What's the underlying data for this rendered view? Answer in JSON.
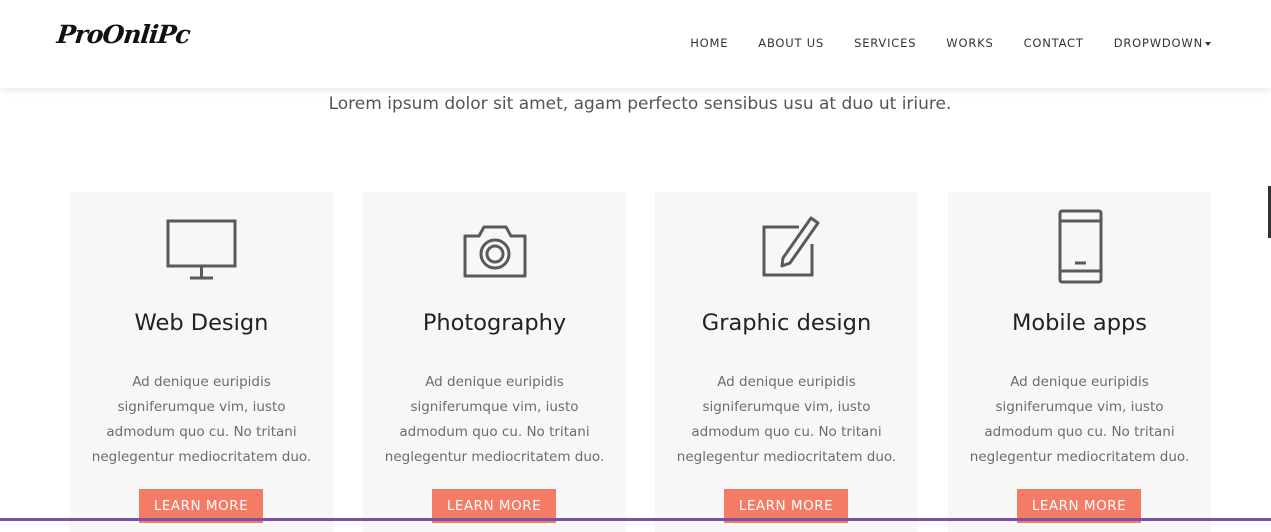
{
  "brand": {
    "logo_text": "ProOnliPc"
  },
  "nav": {
    "items": [
      "HOME",
      "ABOUT US",
      "SERVICES",
      "WORKS",
      "CONTACT",
      "DROPWDOWN"
    ]
  },
  "subtitle": "Lorem ipsum dolor sit amet, agam perfecto sensibus usu at duo ut iriure.",
  "services": [
    {
      "icon": "monitor-icon",
      "title": "Web Design",
      "description": "Ad denique euripidis signiferumque vim, iusto admodum quo cu. No tritani neglegentur mediocritatem duo.",
      "button": "LEARN MORE"
    },
    {
      "icon": "camera-icon",
      "title": "Photography",
      "description": "Ad denique euripidis signiferumque vim, iusto admodum quo cu. No tritani neglegentur mediocritatem duo.",
      "button": "LEARN MORE"
    },
    {
      "icon": "edit-pencil-icon",
      "title": "Graphic design",
      "description": "Ad denique euripidis signiferumque vim, iusto admodum quo cu. No tritani neglegentur mediocritatem duo.",
      "button": "LEARN MORE"
    },
    {
      "icon": "mobile-phone-icon",
      "title": "Mobile apps",
      "description": "Ad denique euripidis signiferumque vim, iusto admodum quo cu. No tritani neglegentur mediocritatem duo.",
      "button": "LEARN MORE"
    }
  ],
  "colors": {
    "accent": "#f47c66",
    "card_bg": "#f7f7f7",
    "bottom_line": "#7b4fa1",
    "icon_stroke": "#5a5a5a"
  }
}
